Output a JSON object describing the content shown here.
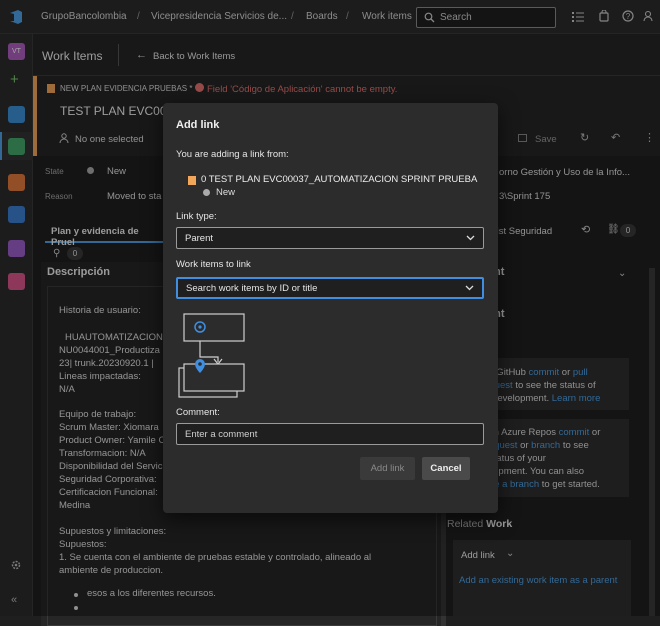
{
  "topbar": {
    "org": "GrupoBancolombia",
    "project": "Vicepresidencia Servicios de...",
    "section": "Boards",
    "page": "Work items",
    "search_placeholder": "Search",
    "separator": "/"
  },
  "rail": {
    "avatar": "VT",
    "plus": "+"
  },
  "pagehead": {
    "title": "Work Items",
    "back_label": "Back to Work Items"
  },
  "workitem": {
    "type_label": "NEW PLAN EVIDENCIA PRUEBAS *",
    "error": "Field 'Código de Aplicación' cannot be empty.",
    "title": "TEST PLAN EVC000",
    "assigned": "No one selected",
    "save_label": "Save",
    "state_label": "State",
    "state_value": "New",
    "reason_label": "Reason",
    "reason_value": "Moved to sta",
    "area_value": "orno Gestión y Uso de la Info...",
    "iteration_value": "3\\Sprint 175",
    "tab_plan": "Plan y evidencia de Pruel",
    "attach_count": "0",
    "tab_checklist": "c List Seguridad",
    "link_count": "0"
  },
  "description": {
    "heading": "Descripción",
    "lines": [
      "Historia de usuario:",
      "HUAUTOMATIZACION",
      "NU0044001_Productiza",
      "23| trunk.20230920.1 |",
      "Lineas impactadas:",
      "N/A",
      "Equipo de trabajo:",
      "Scrum Master:  Xiomara",
      "Product Owner: Yamile C",
      "Transformacion: N/A",
      "Disponibilidad del Servic",
      "Seguridad Corporativa:",
      "Certificacion Funcional:",
      "Medina",
      "Supuestos y limitaciones:",
      "Supuestos:",
      "1. Se cuenta con el ambiente de pruebas estable y controlado, alineado al",
      "ambiente de produccion.",
      "esos a los diferentes recursos."
    ]
  },
  "right": {
    "section1": "nt",
    "section2": "ent",
    "github_pre": "k a GitHub ",
    "github_commit": "commit",
    "github_or": " or ",
    "github_pull": "pull",
    "github_request": "request",
    "github_rest": " to see the status of",
    "github_line3": "ur development. ",
    "learn_more": "Learn more",
    "azure_pre": "k an Azure Repos ",
    "azure_commit": "commit",
    "azure_pull": "l request",
    "azure_or": " or ",
    "azure_branch": "branch",
    "azure_to": " to see",
    "azure_l3": "e status of your",
    "azure_l4": "velopment. You can also",
    "azure_create": "eate a branch",
    "azure_end": " to get started.",
    "related_label": "Related ",
    "related_strong": "Work",
    "add_link": "Add link",
    "add_existing": "Add an existing work item as a parent"
  },
  "dialog": {
    "title": "Add link",
    "adding_from": "You are adding a link from:",
    "source_item": "0 TEST PLAN EVC00037_AUTOMATIZACION SPRINT PRUEBA",
    "source_state": "New",
    "link_type_label": "Link type:",
    "link_type_value": "Parent",
    "work_items_label": "Work items to link",
    "search_placeholder": "Search work items by ID or title",
    "comment_label": "Comment:",
    "comment_placeholder": "Enter a comment",
    "add_button": "Add link",
    "cancel_button": "Cancel"
  },
  "colors": {
    "accent": "#4ea1e6",
    "error": "#e8736f",
    "workitem_stripe": "#f2a65a",
    "focus": "#3f8ee0"
  }
}
